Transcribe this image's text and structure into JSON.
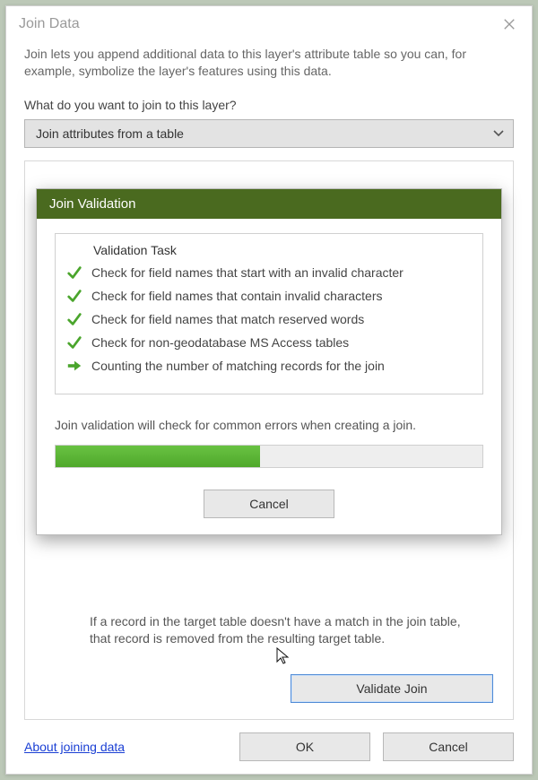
{
  "dialog": {
    "title": "Join Data",
    "intro": "Join lets you append additional data to this layer's attribute table so you can, for example, symbolize the layer's features using this data.",
    "question": "What do you want to join to this layer?",
    "combo_value": "Join attributes from a table",
    "match_note": "If a record in the target table doesn't have a match in the join table, that record is removed from the resulting target table.",
    "validate_label": "Validate Join",
    "about_link": "About joining data",
    "ok_label": "OK",
    "cancel_label": "Cancel"
  },
  "modal": {
    "title": "Join Validation",
    "task_header": "Validation Task",
    "tasks": [
      {
        "status": "done",
        "text": "Check for field names that start with an invalid character"
      },
      {
        "status": "done",
        "text": "Check for field names that contain invalid characters"
      },
      {
        "status": "done",
        "text": "Check for field names that match reserved words"
      },
      {
        "status": "done",
        "text": "Check for non-geodatabase MS Access tables"
      },
      {
        "status": "running",
        "text": "Counting the number of matching records for the join"
      }
    ],
    "note": "Join validation will check for common errors when creating a join.",
    "progress_percent": 48,
    "cancel_label": "Cancel"
  }
}
